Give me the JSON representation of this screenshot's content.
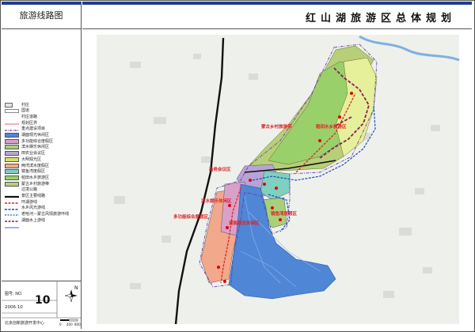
{
  "panel": {
    "title": "旅游线路图"
  },
  "header": {
    "title": "红山湖旅游区总体规划"
  },
  "legend": [
    {
      "label": "村庄",
      "symbol": "village-symbol"
    },
    {
      "label": "国道",
      "symbol": "national-road-symbol"
    },
    {
      "label": "村庄道路",
      "symbol": "village-road-symbol"
    },
    {
      "label": "规划区界",
      "symbol": "planning-boundary-symbol"
    },
    {
      "label": "重点建设项目",
      "symbol": "key-project-symbol"
    },
    {
      "label": "湖面观光休闲区",
      "symbol": "lake-area-symbol",
      "color": "#4f86d6"
    },
    {
      "label": "多功能综合度假区",
      "symbol": "resort-area-symbol",
      "color": "#d9a0c8"
    },
    {
      "label": "滨水娱乐休闲区",
      "symbol": "waterfront-area-symbol",
      "color": "#a8d07a"
    },
    {
      "label": "田农业会议区",
      "symbol": "agri-area-symbol",
      "color": "#b8a3d6"
    },
    {
      "label": "大明观光区",
      "symbol": "daming-area-symbol",
      "color": "#d8e06a"
    },
    {
      "label": "两湾滨水度假区",
      "symbol": "two-bay-area-symbol",
      "color": "#f2a88a"
    },
    {
      "label": "镜鱼湾度假区",
      "symbol": "jingyu-area-symbol",
      "color": "#7fd0c0"
    },
    {
      "label": "稻田水乡旅游区",
      "symbol": "paddy-area-symbol",
      "color": "#9ad06a"
    },
    {
      "label": "蒙古乡村旅游带",
      "symbol": "mongol-belt-symbol",
      "color": "#b6cf78"
    },
    {
      "label": "过境公路",
      "symbol": "transit-road-symbol"
    },
    {
      "label": "景区主要线路",
      "symbol": "main-route-symbol"
    },
    {
      "label": "环湖游线",
      "symbol": "lakeloop-route-symbol"
    },
    {
      "label": "水乡风光游线",
      "symbol": "watertown-route-symbol"
    },
    {
      "label": "老哈河－蒙古风情旅游环线",
      "symbol": "laoha-loop-symbol"
    },
    {
      "label": "湖面水上游线",
      "symbol": "lake-water-route-symbol"
    }
  ],
  "footer": {
    "fig_label": "图号: NO.",
    "fig_number": "10",
    "date": "2006.10",
    "org": "北京创新旅游开发中心",
    "north": "N",
    "scale_labels": [
      "0",
      "400",
      "800"
    ]
  },
  "map_labels": [
    {
      "text": "蒙古乡村旅游带",
      "color": "red"
    },
    {
      "text": "稻田水乡旅游区",
      "color": "red"
    },
    {
      "text": "商务会议区",
      "color": "red"
    },
    {
      "text": "滨水娱乐休闲区",
      "color": "red"
    },
    {
      "text": "多功能综合度假区",
      "color": "red"
    },
    {
      "text": "镜鱼湾度假区",
      "color": "red"
    },
    {
      "text": "湖面观光休闲区",
      "color": "red"
    }
  ]
}
